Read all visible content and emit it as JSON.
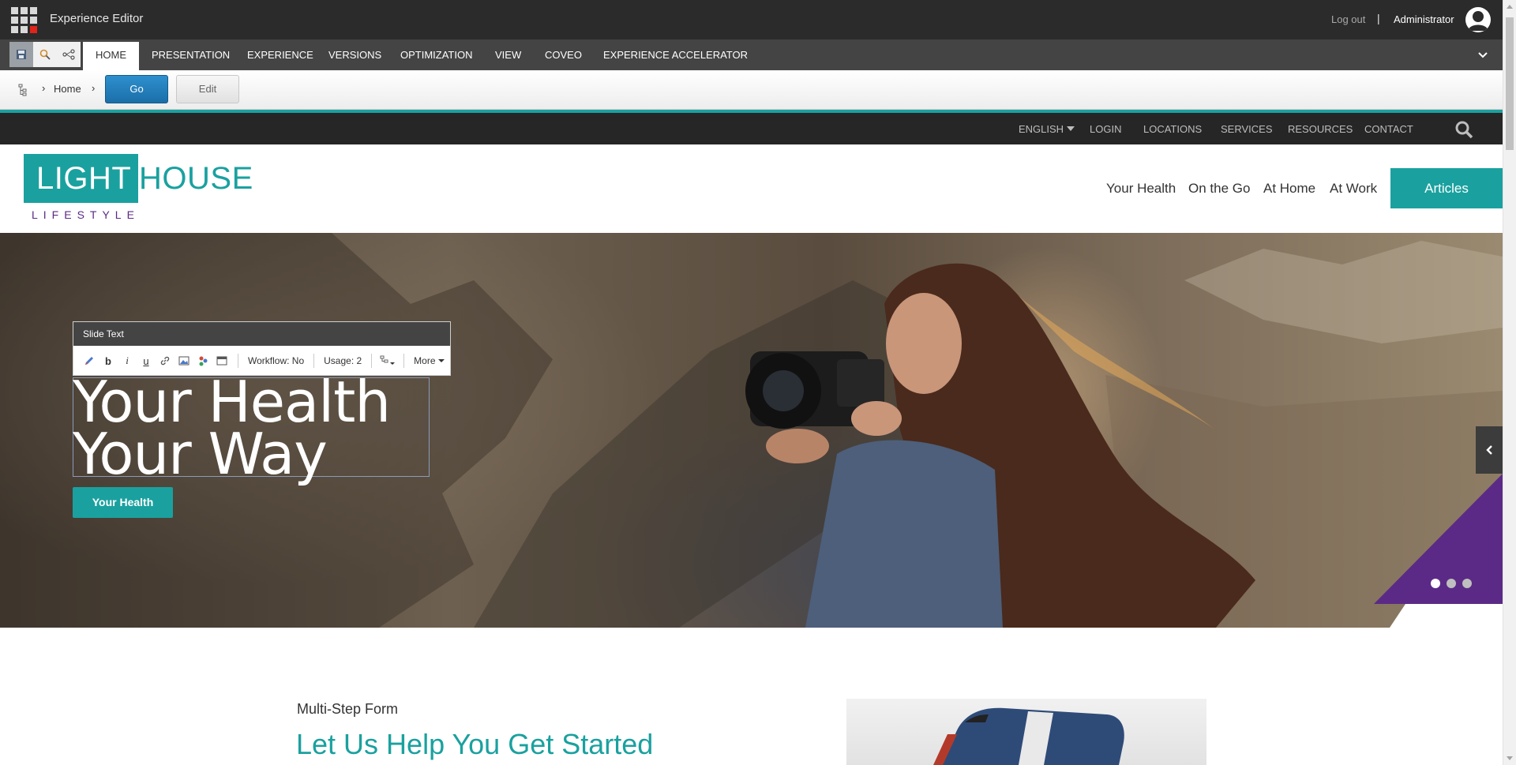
{
  "app": {
    "title": "Experience Editor",
    "logout": "Log out",
    "separator": "|",
    "user": "Administrator"
  },
  "ribbon": {
    "tabs": [
      {
        "label": "HOME",
        "active": true
      },
      {
        "label": "PRESENTATION"
      },
      {
        "label": "EXPERIENCE"
      },
      {
        "label": "VERSIONS"
      },
      {
        "label": "OPTIMIZATION"
      },
      {
        "label": "VIEW"
      },
      {
        "label": "COVEO"
      },
      {
        "label": "EXPERIENCE ACCELERATOR"
      }
    ]
  },
  "breadcrumb": {
    "home": "Home",
    "go_label": "Go",
    "edit_label": "Edit"
  },
  "site": {
    "utility_nav": {
      "language": "ENGLISH",
      "items": [
        "LOGIN",
        "LOCATIONS",
        "SERVICES",
        "RESOURCES",
        "CONTACT"
      ]
    },
    "logo": {
      "part1": "LIGHT",
      "part2": "HOUSE",
      "tagline": "LIFESTYLE"
    },
    "main_nav": [
      "Your Health",
      "On the Go",
      "At Home",
      "At Work"
    ],
    "articles_label": "Articles",
    "brand_color": "#1aa19f",
    "accent_color": "#5b2a86"
  },
  "slide_editor": {
    "title": "Slide Text",
    "workflow": "Workflow: No",
    "usage": "Usage: 2",
    "more": "More"
  },
  "hero": {
    "line1": "Your Health",
    "line2": "Your Way",
    "button": "Your Health",
    "slide_count": 3,
    "active_slide": 1
  },
  "content": {
    "eyebrow": "Multi-Step Form",
    "headline": "Let Us Help You Get Started"
  }
}
